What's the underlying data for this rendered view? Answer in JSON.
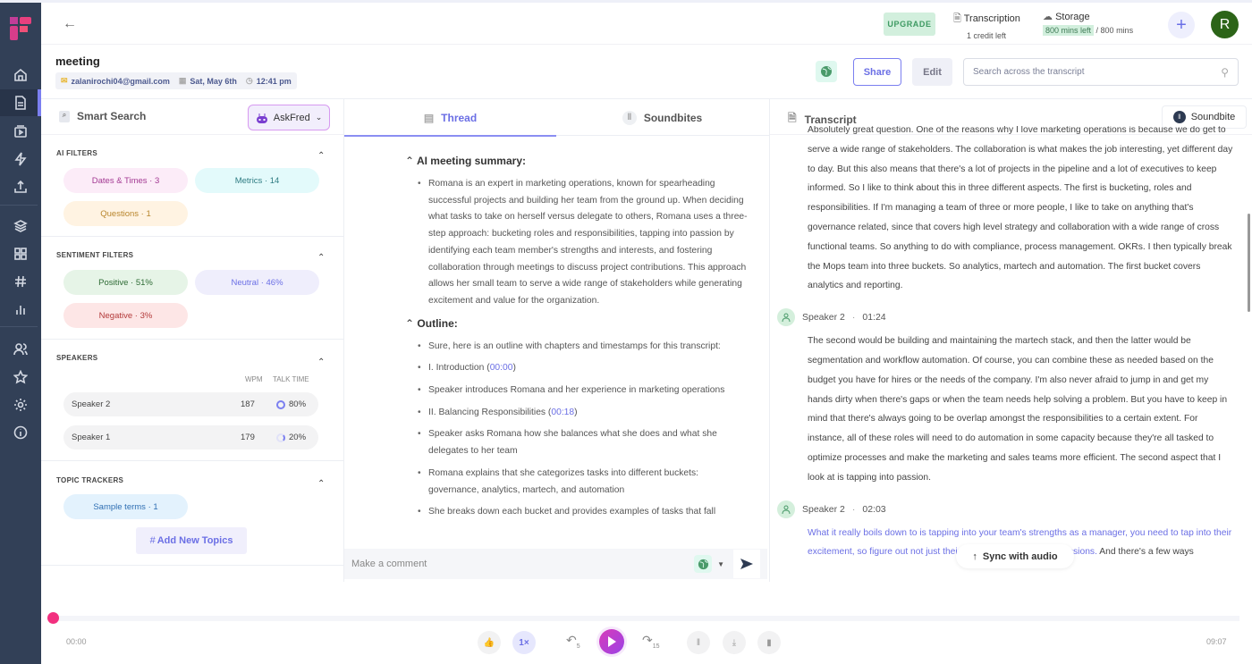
{
  "app": {
    "upgrade_label": "UPGRADE",
    "transcription": {
      "label": "Transcription",
      "credits": "1 credit left"
    },
    "storage": {
      "label": "Storage",
      "left": "800 mins left",
      "total": "/ 800 mins"
    },
    "avatar_initial": "R",
    "plus_label": "+"
  },
  "meeting": {
    "title": "meeting",
    "email": "zalanirochi04@gmail.com",
    "date": "Sat, May 6th",
    "time": "12:41 pm"
  },
  "actions": {
    "share": "Share",
    "edit": "Edit",
    "search_placeholder": "Search across the transcript"
  },
  "smart_search": {
    "title": "Smart Search",
    "askfred": "AskFred",
    "ai_filters": {
      "label": "AI FILTERS",
      "chips": [
        {
          "label": "Dates & Times · 3",
          "bg": "#fcecf8",
          "fg": "#a33a93"
        },
        {
          "label": "Metrics · 14",
          "bg": "#e3fafb",
          "fg": "#2f7c83"
        },
        {
          "label": "Questions · 1",
          "bg": "#fff3e2",
          "fg": "#b8862d"
        }
      ]
    },
    "sentiment_filters": {
      "label": "SENTIMENT FILTERS",
      "chips": [
        {
          "label": "Positive · 51%",
          "bg": "#e6f4e7",
          "fg": "#2e6b35"
        },
        {
          "label": "Neutral · 46%",
          "bg": "#efeefc",
          "fg": "#6b6fe5"
        },
        {
          "label": "Negative · 3%",
          "bg": "#fde6e6",
          "fg": "#b33a3a"
        }
      ]
    },
    "speakers": {
      "label": "SPEAKERS",
      "wpm_header": "WPM",
      "talk_header": "TALK TIME",
      "rows": [
        {
          "name": "Speaker 2",
          "wpm": "187",
          "talk": "80%",
          "talk_fraction": 0.8
        },
        {
          "name": "Speaker 1",
          "wpm": "179",
          "talk": "20%",
          "talk_fraction": 0.2
        }
      ]
    },
    "topic_trackers": {
      "label": "TOPIC TRACKERS",
      "chips": [
        {
          "label": "Sample terms · 1",
          "bg": "#e3f2fd",
          "fg": "#2f6fb3"
        }
      ],
      "add_label": "Add New Topics"
    }
  },
  "thread": {
    "tabs": [
      {
        "label": "Thread",
        "active": true
      },
      {
        "label": "Soundbites",
        "active": false
      }
    ],
    "summary_heading": "AI meeting summary:",
    "summary": "Romana is an expert in marketing operations, known for spearheading successful projects and building her team from the ground up. When deciding what tasks to take on herself versus delegate to others, Romana uses a three-step approach: bucketing roles and responsibilities, tapping into passion by identifying each team member's strengths and interests, and fostering collaboration through meetings to discuss project contributions. This approach allows her small team to serve a wide range of stakeholders while generating excitement and value for the organization.",
    "outline_heading": "Outline:",
    "outline": [
      {
        "text": "Sure, here is an outline with chapters and timestamps for this transcript:"
      },
      {
        "text": "I. Introduction (",
        "ts": "00:00",
        "tail": ")"
      },
      {
        "text": "Speaker introduces Romana and her experience in marketing operations"
      },
      {
        "text": "II. Balancing Responsibilities (",
        "ts": "00:18",
        "tail": ")"
      },
      {
        "text": "Speaker asks Romana how she balances what she does and what she delegates to her team"
      },
      {
        "text": "Romana explains that she categorizes tasks into different buckets: governance, analytics, martech, and automation"
      },
      {
        "text": "She breaks down each bucket and provides examples of tasks that fall"
      }
    ],
    "comment_placeholder": "Make a comment"
  },
  "transcript": {
    "title": "Transcript",
    "soundbite_label": "Soundbite",
    "blocks": [
      {
        "speaker": null,
        "time": null,
        "text": "Absolutely great question. One of the reasons why I love marketing operations is because we do get to serve a wide range of stakeholders. The collaboration is what makes the job interesting, yet different day to day. But this also means that there's a lot of projects in the pipeline and a lot of executives to keep informed. So I like to think about this in three different aspects. The first is bucketing, roles and responsibilities. If I'm managing a team of three or more people, I like to take on anything that's governance related, since that covers high level strategy and collaboration with a wide range of cross functional teams. So anything to do with compliance, process management. OKRs. I then typically break the Mops team into three buckets. So analytics, martech and automation. The first bucket covers analytics and reporting."
      },
      {
        "speaker": "Speaker 2",
        "time": "01:24",
        "text": "The second would be building and maintaining the martech stack, and then the latter would be segmentation and workflow automation. Of course, you can combine these as needed based on the budget you have for hires or the needs of the company. I'm also never afraid to jump in and get my hands dirty when there's gaps or when the team needs help solving a problem. But you have to keep in mind that there's always going to be overlap amongst the responsibilities to a certain extent. For instance, all of these roles will need to do automation in some capacity because they're all tasked to optimize processes and make the marketing and sales teams more efficient. The second aspect that I look at is tapping into passion."
      },
      {
        "speaker": "Speaker 2",
        "time": "02:03",
        "highlight": "What it really boils down to is tapping into your team's strengths as a manager, you need to tap into their excitement, so figure out not just their skill sets, but also their passions.",
        "text": " And there's a few ways"
      }
    ],
    "sync_label": "Sync with audio"
  },
  "player": {
    "current": "00:00",
    "duration": "09:07",
    "speed": "1×",
    "back_seconds": "5",
    "forward_seconds": "15",
    "progress_fraction": 0.0
  }
}
